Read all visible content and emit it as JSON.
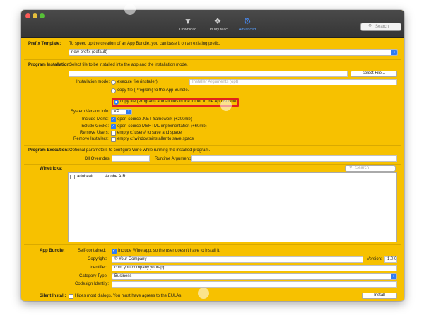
{
  "toolbar": {
    "tabs": [
      {
        "label": "Download",
        "icon": "download-icon"
      },
      {
        "label": "On My Mac",
        "icon": "on-my-mac-icon"
      },
      {
        "label": "Advanced",
        "icon": "advanced-icon"
      }
    ],
    "active_tab": "Advanced",
    "search_placeholder": "Search"
  },
  "prefix_template": {
    "label": "Prefix Template:",
    "description": "To speed up the creation of an App Bundle, you can base it on an existing prefix.",
    "selected": "new prefix (default)"
  },
  "program_installation": {
    "label": "Program Installation:",
    "description": "Select file to be installed into the app and the installation mode.",
    "file_value": "",
    "select_file_button": "select File...",
    "installation_mode_label": "Installation mode:",
    "modes": [
      {
        "label": "execute file (installer)",
        "selected": false
      },
      {
        "label": "copy file (Program)  to the App Bundle.",
        "selected": false
      },
      {
        "label": "copy file (Program)  and all files in the folder to the App Bundle.",
        "selected": true
      }
    ],
    "installer_arguments_placeholder": "Installer Arguments (opt)",
    "system_version_label": "System Version Info:",
    "system_version": "XP",
    "include_mono_label": "Include Mono:",
    "include_mono_text": "open-source .NET framework  (+200mb)",
    "include_mono": true,
    "include_gecko_label": "Include Gecko:",
    "include_gecko_text": "open-source MSHTML implementation (+60mb)",
    "include_gecko": true,
    "remove_users_label": "Remove Users:",
    "remove_users_text": "empty c:\\users\\ to save and space",
    "remove_users": false,
    "remove_installers_label": "Remove Installers:",
    "remove_installers_text": "empty c:\\windows\\installer to save space",
    "remove_installers": false
  },
  "program_execution": {
    "label": "Program Execution:",
    "description": "Optional parameters to configure Wine while running the installed program.",
    "dll_overrides_label": "Dll Overrides:",
    "dll_overrides": "",
    "runtime_arguments_label": "Runtime Arguments:",
    "runtime_arguments": ""
  },
  "winetricks": {
    "label": "Winetricks:",
    "search_placeholder": "Search",
    "items": [
      {
        "id": "adobeair",
        "title": "Adobe AIR",
        "checked": false
      }
    ]
  },
  "app_bundle": {
    "label": "App Bundle:",
    "self_contained_label": "Self-contained:",
    "self_contained_text": "Include Wine.app, so the user doesn't have to install it.",
    "self_contained": true,
    "copyright_label": "Copyright:",
    "copyright": "© Your Company",
    "version_label": "Version:",
    "version": "1.0.0",
    "identifier_label": "Identifier:",
    "identifier": "com.yourcompany.yourapp",
    "category_label": "Category Type:",
    "category": "Business",
    "codesign_label": "Codesign Identity:",
    "codesign": ""
  },
  "silent_install": {
    "label": "Silent Install:",
    "text": "Hides most dialogs. You must have agrees to the EULAs.",
    "checked": false,
    "install_button": "Install"
  },
  "colors": {
    "background": "#f7c100",
    "accent": "#2e7cf6",
    "highlight_box": "#e0231c",
    "titlebar": "#3d3d3d"
  }
}
